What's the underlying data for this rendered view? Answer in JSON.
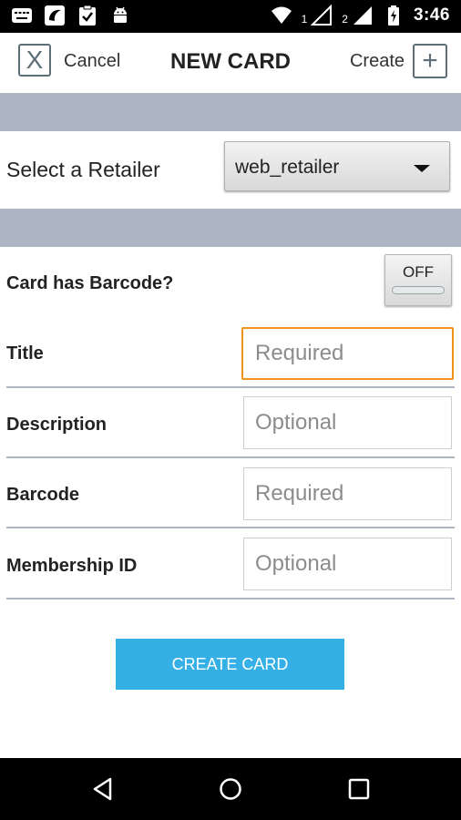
{
  "status_bar": {
    "time": "3:46",
    "sim1": "1",
    "sim2": "2",
    "icons_left": [
      "keyboard-icon",
      "app-icon",
      "clipboard-check-icon",
      "android-icon"
    ],
    "icons_right": [
      "wifi-icon",
      "signal-icon",
      "signal-icon",
      "battery-charging-icon"
    ]
  },
  "header": {
    "cancel_symbol": "X",
    "cancel_label": "Cancel",
    "title": "NEW CARD",
    "create_label": "Create",
    "create_symbol": "+"
  },
  "retailer": {
    "label": "Select a Retailer",
    "selected": "web_retailer"
  },
  "barcode_toggle": {
    "label": "Card has Barcode?",
    "state": "OFF"
  },
  "fields": {
    "title": {
      "label": "Title",
      "placeholder": "Required",
      "value": ""
    },
    "description": {
      "label": "Description",
      "placeholder": "Optional",
      "value": ""
    },
    "barcode": {
      "label": "Barcode",
      "placeholder": "Required",
      "value": ""
    },
    "membership": {
      "label": "Membership ID",
      "placeholder": "Optional",
      "value": ""
    }
  },
  "create_button": {
    "label": "CREATE CARD"
  },
  "colors": {
    "accent": "#35b0e6",
    "focus": "#f0901d",
    "band": "#adb5c3",
    "status_bar": "#000000"
  },
  "nav": {
    "back": "back-icon",
    "home": "home-icon",
    "recents": "recents-icon"
  }
}
